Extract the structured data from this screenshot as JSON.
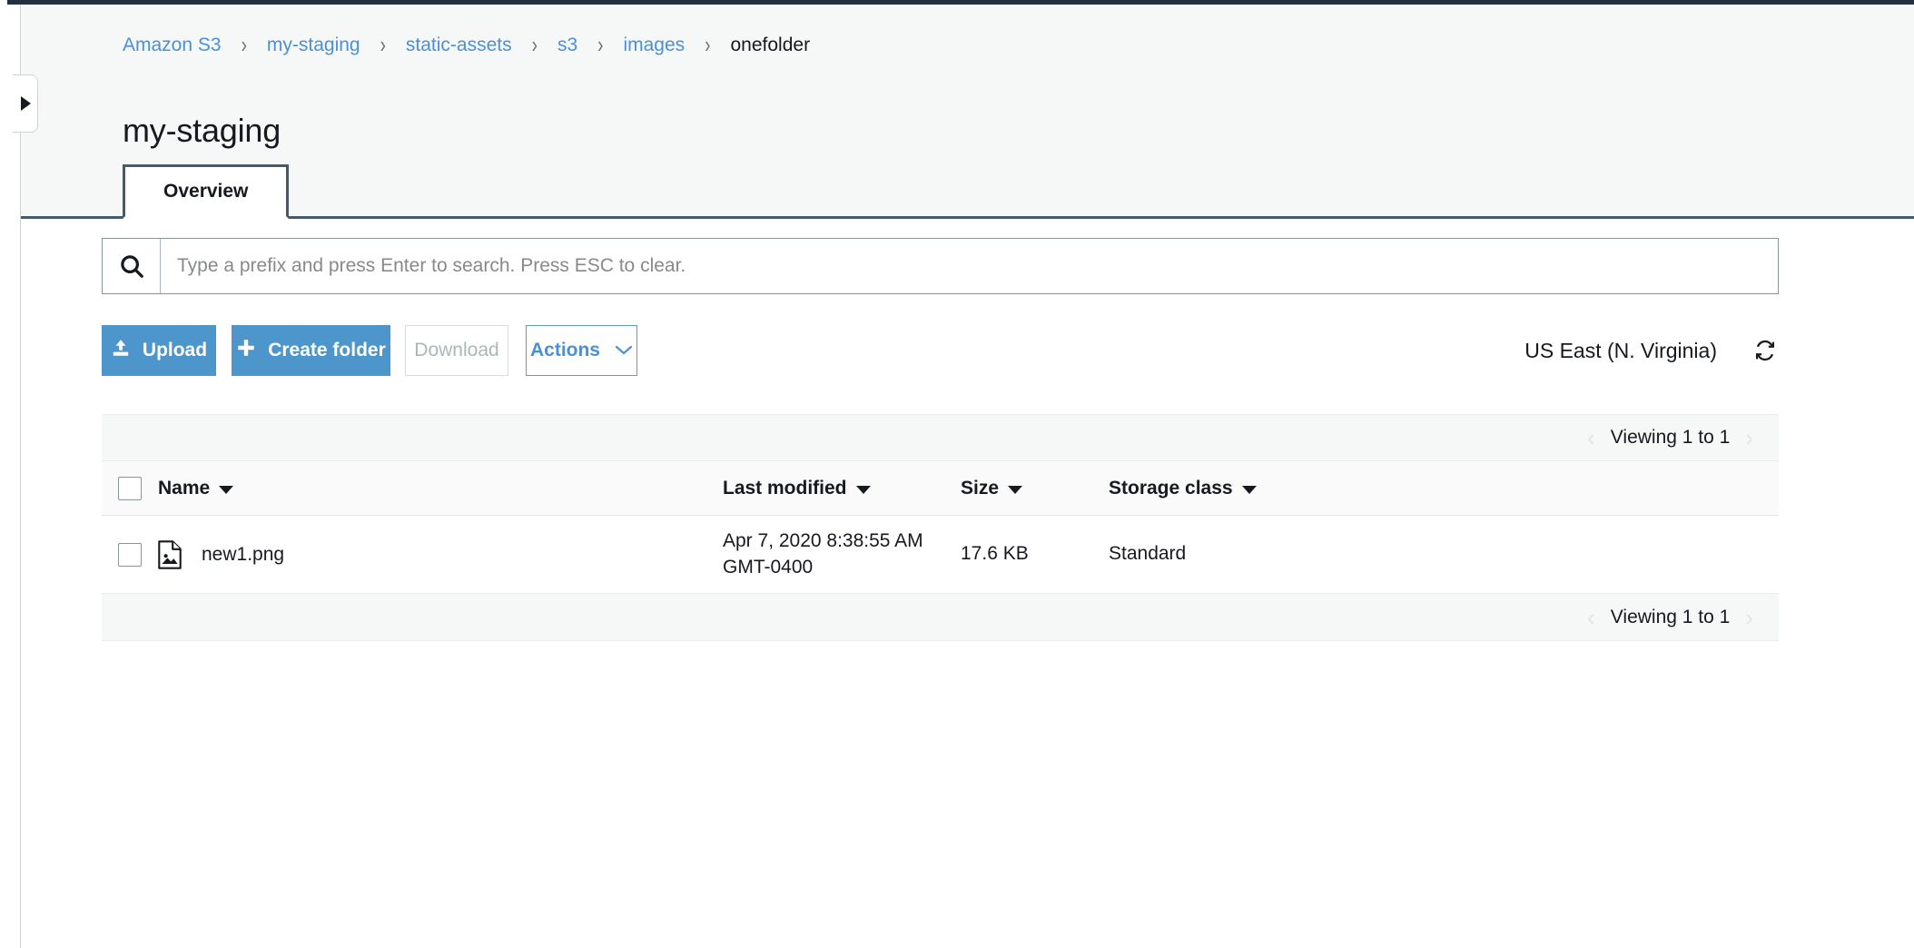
{
  "breadcrumb": {
    "separator": "›",
    "items": [
      {
        "label": "Amazon S3",
        "current": false
      },
      {
        "label": "my-staging",
        "current": false
      },
      {
        "label": "static-assets",
        "current": false
      },
      {
        "label": "s3",
        "current": false
      },
      {
        "label": "images",
        "current": false
      },
      {
        "label": "onefolder",
        "current": true
      }
    ]
  },
  "page": {
    "title": "my-staging"
  },
  "tabs": [
    {
      "label": "Overview",
      "active": true
    }
  ],
  "search": {
    "placeholder": "Type a prefix and press Enter to search. Press ESC to clear.",
    "value": "",
    "icon": "search-icon"
  },
  "toolbar": {
    "upload_label": "Upload",
    "create_folder_label": "Create folder",
    "download_label": "Download",
    "actions_label": "Actions",
    "region_label": "US East (N. Virginia)",
    "refresh_icon": "refresh-icon",
    "upload_icon": "upload-icon",
    "plus_icon": "plus-icon",
    "chevron_down_icon": "chevron-down-icon"
  },
  "pagination": {
    "top_text": "Viewing 1 to 1",
    "bottom_text": "Viewing 1 to 1",
    "prev_icon": "‹",
    "next_icon": "›"
  },
  "table": {
    "columns": [
      {
        "label": "Name",
        "sortable": true
      },
      {
        "label": "Last modified",
        "sortable": true
      },
      {
        "label": "Size",
        "sortable": true
      },
      {
        "label": "Storage class",
        "sortable": true
      }
    ],
    "rows": [
      {
        "name": "new1.png",
        "icon": "image-file-icon",
        "last_modified": "Apr 7, 2020 8:38:55 AM GMT-0400",
        "size": "17.6 KB",
        "storage_class": "Standard",
        "selected": false
      }
    ]
  },
  "colors": {
    "primary_blue": "#4d96cc",
    "link_blue": "#4a90d9",
    "tab_border": "#44596b",
    "header_bg": "#f6f7f7",
    "disabled_text": "#aab7b8"
  }
}
